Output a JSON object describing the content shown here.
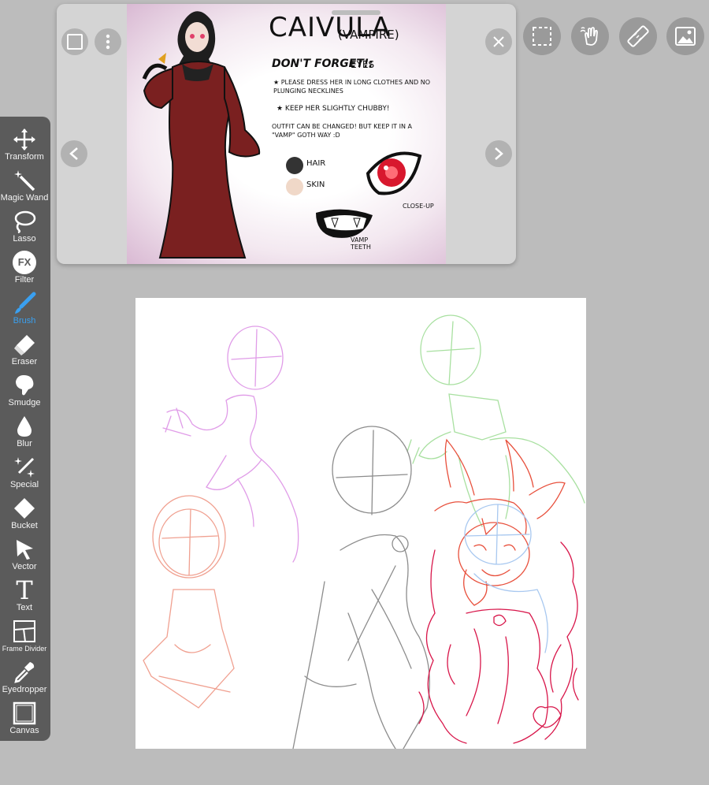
{
  "reference": {
    "image_alt": "Character reference sheet",
    "sheet_title": "CAIVULA",
    "sheet_subtitle": "(VAMPIRE)",
    "dont_forget_label": "DON'T FORGET!:",
    "eyes_label": "EYES",
    "note_1": "★ PLEASE DRESS HER IN LONG CLOTHES AND NO PLUNGING NECKLINES",
    "note_2": "★ KEEP HER SLIGHTLY CHUBBY!",
    "note_3": "OUTFIT CAN BE CHANGED! BUT KEEP IT IN A \"VAMP\" GOTH WAY :D",
    "hair_label": "HAIR",
    "skin_label": "SKIN",
    "closeup_label": "CLOSE-UP",
    "teeth_label": "VAMP TEETH",
    "hair_color": "#333333",
    "skin_color": "#f0d8c8",
    "dress_color": "#7a2020"
  },
  "top_bar": {
    "selection_icon": "selection-icon",
    "gesture_icon": "hand-gesture-icon",
    "ruler_icon": "ruler-icon",
    "reference_icon": "reference-image-icon"
  },
  "toolbar": {
    "active_color": "#3aa0f0",
    "tools": [
      {
        "id": "transform",
        "label": "Transform"
      },
      {
        "id": "magic-wand",
        "label": "Magic Wand"
      },
      {
        "id": "lasso",
        "label": "Lasso"
      },
      {
        "id": "filter",
        "label": "Filter",
        "glyph": "FX"
      },
      {
        "id": "brush",
        "label": "Brush"
      },
      {
        "id": "eraser",
        "label": "Eraser"
      },
      {
        "id": "smudge",
        "label": "Smudge"
      },
      {
        "id": "blur",
        "label": "Blur"
      },
      {
        "id": "special",
        "label": "Special"
      },
      {
        "id": "bucket",
        "label": "Bucket"
      },
      {
        "id": "vector",
        "label": "Vector"
      },
      {
        "id": "text",
        "label": "Text",
        "glyph": "T"
      },
      {
        "id": "frame-divider",
        "label": "Frame Divider"
      },
      {
        "id": "eyedropper",
        "label": "Eyedropper"
      },
      {
        "id": "canvas",
        "label": "Canvas"
      }
    ]
  }
}
